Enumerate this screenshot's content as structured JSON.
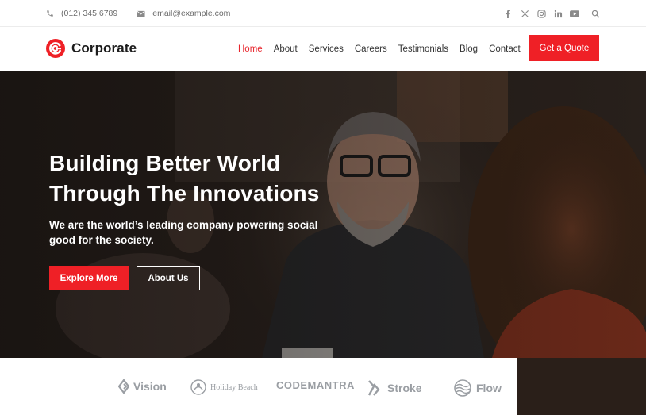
{
  "topbar": {
    "phone": "(012) 345 6789",
    "email": "email@example.com",
    "social": [
      "facebook-icon",
      "x-icon",
      "instagram-icon",
      "linkedin-icon",
      "youtube-icon",
      "search-icon"
    ]
  },
  "header": {
    "brand": "Corporate",
    "nav": [
      {
        "label": "Home",
        "active": true
      },
      {
        "label": "About",
        "active": false
      },
      {
        "label": "Services",
        "active": false
      },
      {
        "label": "Careers",
        "active": false
      },
      {
        "label": "Testimonials",
        "active": false
      },
      {
        "label": "Blog",
        "active": false
      },
      {
        "label": "Contact",
        "active": false
      }
    ],
    "cta": "Get a Quote"
  },
  "hero": {
    "title_line1": "Building Better World",
    "title_line2": "Through The Innovations",
    "subtitle": "We are the world’s leading company powering social good for the society.",
    "primary_button": "Explore More",
    "secondary_button": "About Us"
  },
  "clients": [
    "Vision",
    "Holiday Beach",
    "CODEMANTRA",
    "Stroke",
    "Flow"
  ],
  "colors": {
    "accent": "#ef2026",
    "text": "#222222",
    "muted": "#9a9ea3"
  }
}
